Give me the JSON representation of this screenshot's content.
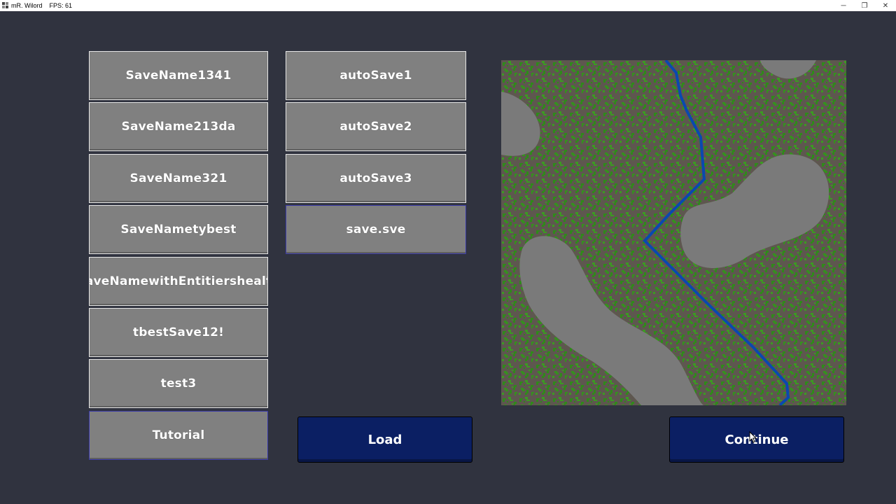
{
  "window": {
    "title": "mR. Wilord",
    "fps": "FPS: 61",
    "controls": [
      "─",
      "❐",
      "✕"
    ]
  },
  "saves": {
    "column1": [
      "SaveName1341",
      "SaveName213da",
      "SaveName321",
      "SaveNametybest",
      "SaveNamewithEntitiershealth",
      "tbestSave12!",
      "test3",
      "Tutorial"
    ],
    "column2": [
      "autoSave1",
      "autoSave2",
      "autoSave3",
      "save.sve"
    ]
  },
  "buttons": {
    "load": "Load",
    "continue": "Continue"
  },
  "colors": {
    "background": "#30333f",
    "tile": "#808080",
    "action": "#0b1f63",
    "map_dirt": "#5e574f",
    "map_grass": "#2f8a1a",
    "map_rock": "#7a7a7a",
    "map_river": "#0a48b0"
  },
  "icons": {
    "app": "app-icon",
    "minimize": "minimize-icon",
    "maximize": "maximize-icon",
    "close": "close-icon",
    "cursor": "mouse-cursor-icon"
  }
}
